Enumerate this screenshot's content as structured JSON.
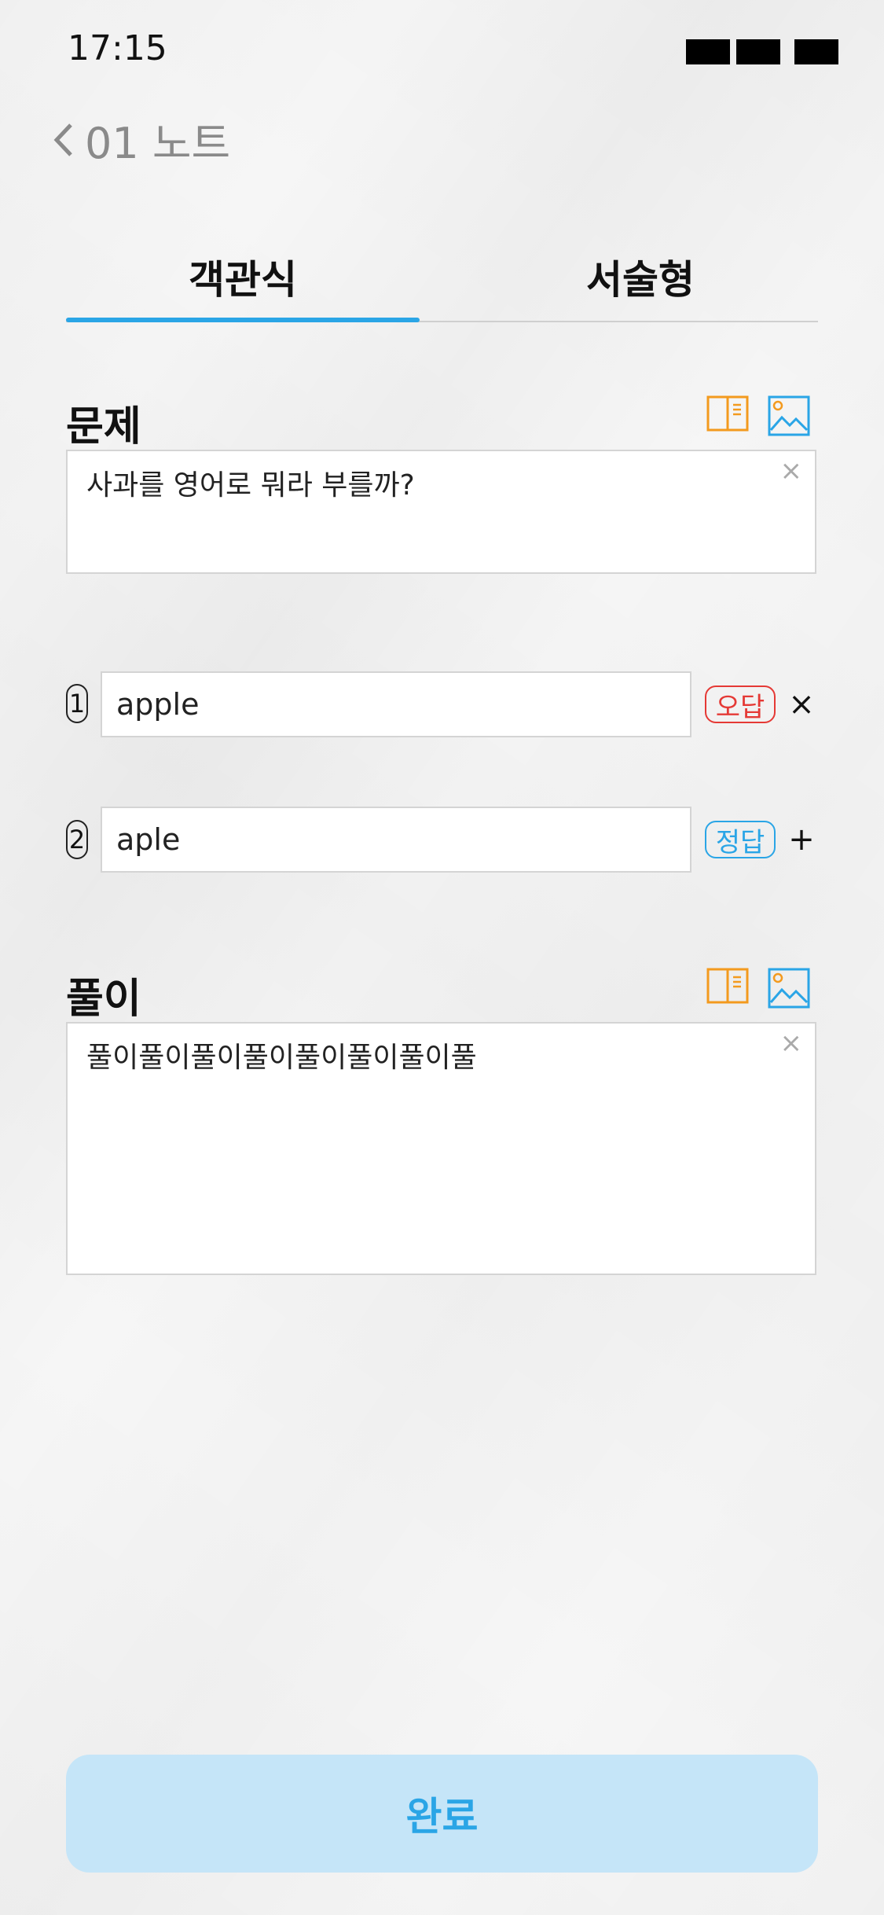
{
  "status": {
    "time": "17:15"
  },
  "header": {
    "back_label": "01 노트"
  },
  "tabs": [
    {
      "label": "객관식",
      "active": true
    },
    {
      "label": "서술형",
      "active": false
    }
  ],
  "question": {
    "title": "문제",
    "text": "사과를 영어로 뭐라 부를까?",
    "clear_symbol": "×"
  },
  "answers": [
    {
      "number": "1",
      "value": "apple",
      "badge": "오답",
      "action": "×"
    },
    {
      "number": "2",
      "value": "aple",
      "badge": "정답",
      "action": "+"
    }
  ],
  "solution": {
    "title": "풀이",
    "text": "풀이풀이풀이풀이풀이풀이풀이풀",
    "clear_symbol": "×"
  },
  "done_button": {
    "label": "완료"
  },
  "colors": {
    "accent_blue": "#2aa5e6",
    "accent_orange": "#f39a1e",
    "wrong_red": "#e53935",
    "button_bg": "#c5e5f8"
  },
  "icons": [
    "chevron-left-icon",
    "book-icon",
    "image-icon"
  ]
}
